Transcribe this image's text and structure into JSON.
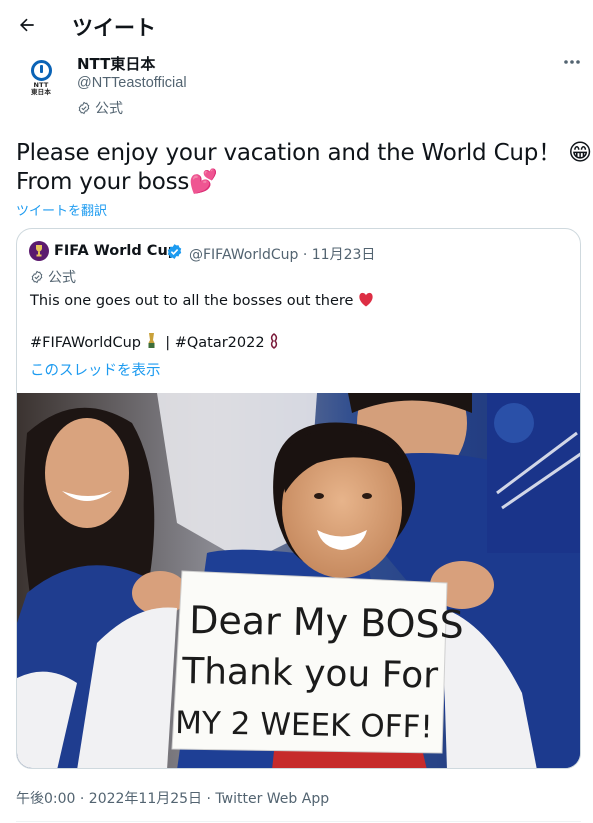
{
  "header": {
    "title": "ツイート"
  },
  "tweet": {
    "author_name": "NTT東日本",
    "author_handle": "@NTTeastofficial",
    "author_badge": "公式",
    "avatar_text": "NTT\n東日本",
    "text_line1": "Please enjoy your vacation and the World Cup！",
    "text_line2": "From your boss",
    "emoji_1": "😁",
    "emoji_2": "💕",
    "translate_label": "ツイートを翻訳",
    "timestamp": "午後0:00 · 2022年11月25日 · Twitter Web App"
  },
  "quote": {
    "author_name": "FIFA World Cup",
    "author_handle": "@FIFAWorldCup · 11月23日",
    "author_badge": "公式",
    "text": "This one goes out to all the bosses out there",
    "text_emoji": "❤️",
    "hashtag_1": "#FIFAWorldCup",
    "separator": "| ",
    "hashtag_2": "#Qatar2022",
    "thread_link": "このスレッドを表示",
    "photo_sign_line1": "Dear My BOSS",
    "photo_sign_line2": "Thank you For",
    "photo_sign_line3": "MY 2 WEEK OFF!"
  },
  "colors": {
    "link": "#1d9bf0",
    "secondary_text": "#536471",
    "ntt_blue": "#0a63b6",
    "verified": "#1d9bf0",
    "fifa_purple": "#5b1a6e",
    "japan_jersey": "#1b3a8c"
  },
  "icons": {
    "back": "arrow-left-icon",
    "more": "more-horizontal-icon",
    "badge": "official-check-icon",
    "verified": "verified-badge-icon"
  }
}
